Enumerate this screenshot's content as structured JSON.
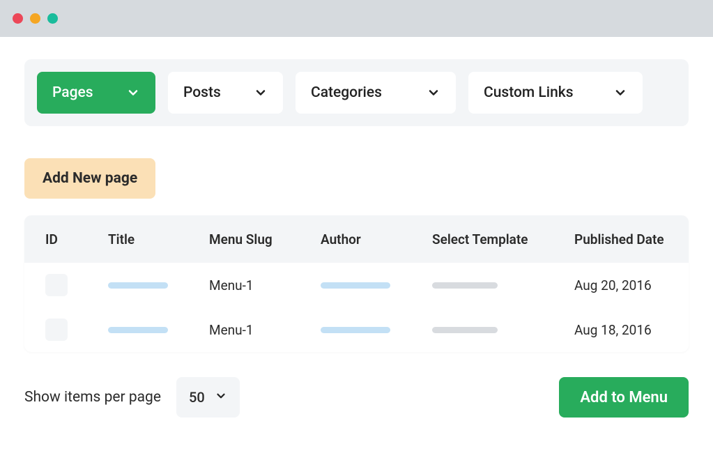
{
  "tabs": {
    "pages": "Pages",
    "posts": "Posts",
    "categories": "Categories",
    "custom_links": "Custom Links"
  },
  "actions": {
    "add_new_page": "Add New page",
    "add_to_menu": "Add to Menu"
  },
  "table": {
    "headers": {
      "id": "ID",
      "title": "Title",
      "menu_slug": "Menu Slug",
      "author": "Author",
      "select_template": "Select Template",
      "published_date": "Published Date"
    },
    "rows": [
      {
        "menu_slug": "Menu-1",
        "published_date": "Aug 20, 2016"
      },
      {
        "menu_slug": "Menu-1",
        "published_date": "Aug 18, 2016"
      }
    ]
  },
  "pagination": {
    "label": "Show items per page",
    "value": "50"
  }
}
